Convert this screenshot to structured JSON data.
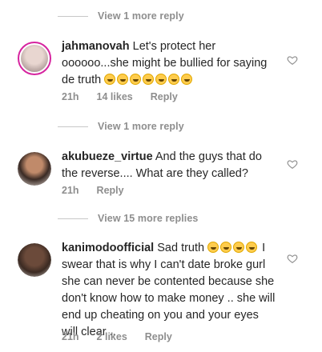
{
  "threads": [
    {
      "view_more": "View 1 more reply"
    },
    {
      "comment": {
        "username": "jahmanovah",
        "text": "Let's protect her oooooo...she might be bullied for saying de truth",
        "emoji_count": 7,
        "time": "21h",
        "likes": "14 likes",
        "reply": "Reply"
      }
    },
    {
      "view_more": "View 1 more reply"
    },
    {
      "comment": {
        "username": "akubueze_virtue",
        "text": "And the guys that do the reverse.... What are they called?",
        "time": "21h",
        "reply": "Reply"
      }
    },
    {
      "view_more": "View 15 more replies"
    },
    {
      "comment": {
        "username": "kanimodoofficial",
        "text_before_emoji": "Sad truth",
        "emoji_count": 4,
        "text_after_emoji": "I swear that is why I can't date broke gurl she can never be contented because she don't know how to make money .. she will end up cheating on you and your eyes will clear ..",
        "time": "21h",
        "likes": "2 likes",
        "reply": "Reply"
      }
    }
  ]
}
